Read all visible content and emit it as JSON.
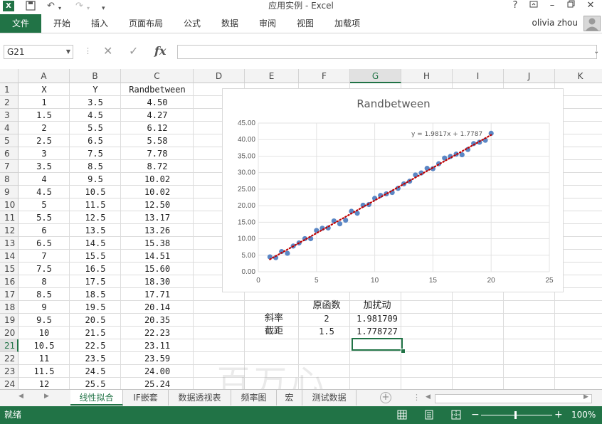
{
  "window": {
    "title": "应用实例 - Excel",
    "help_label": "?",
    "quick_access": {
      "undo_icon": "undo-icon",
      "redo_icon": "redo-icon",
      "save_icon": "save-icon"
    }
  },
  "ribbon": {
    "file_label": "文件",
    "tabs": [
      "开始",
      "插入",
      "页面布局",
      "公式",
      "数据",
      "审阅",
      "视图",
      "加载项"
    ],
    "user_name": "olivia zhou"
  },
  "formula_bar": {
    "name_box": "G21",
    "fx_label": "fx",
    "formula": ""
  },
  "columns": [
    "A",
    "B",
    "C",
    "D",
    "E",
    "F",
    "G",
    "H",
    "I",
    "J",
    "K"
  ],
  "rows": [
    "1",
    "2",
    "3",
    "4",
    "5",
    "6",
    "7",
    "8",
    "9",
    "10",
    "11",
    "12",
    "13",
    "14",
    "15",
    "16",
    "17",
    "18",
    "19",
    "20",
    "21",
    "22",
    "23",
    "24"
  ],
  "cells": {
    "headers": [
      "X",
      "Y",
      "Randbetween"
    ],
    "data": [
      [
        "1",
        "3.5",
        "4.50"
      ],
      [
        "1.5",
        "4.5",
        "4.27"
      ],
      [
        "2",
        "5.5",
        "6.12"
      ],
      [
        "2.5",
        "6.5",
        "5.58"
      ],
      [
        "3",
        "7.5",
        "7.78"
      ],
      [
        "3.5",
        "8.5",
        "8.72"
      ],
      [
        "4",
        "9.5",
        "10.02"
      ],
      [
        "4.5",
        "10.5",
        "10.02"
      ],
      [
        "5",
        "11.5",
        "12.50"
      ],
      [
        "5.5",
        "12.5",
        "13.17"
      ],
      [
        "6",
        "13.5",
        "13.26"
      ],
      [
        "6.5",
        "14.5",
        "15.38"
      ],
      [
        "7",
        "15.5",
        "14.51"
      ],
      [
        "7.5",
        "16.5",
        "15.60"
      ],
      [
        "8",
        "17.5",
        "18.30"
      ],
      [
        "8.5",
        "18.5",
        "17.71"
      ],
      [
        "9",
        "19.5",
        "20.14"
      ],
      [
        "9.5",
        "20.5",
        "20.35"
      ],
      [
        "10",
        "21.5",
        "22.23"
      ],
      [
        "10.5",
        "22.5",
        "23.11"
      ],
      [
        "11",
        "23.5",
        "23.59"
      ],
      [
        "11.5",
        "24.5",
        "24.00"
      ],
      [
        "12",
        "25.5",
        "25.24"
      ]
    ],
    "summary": {
      "col_f_header": "原函数",
      "col_g_header": "加扰动",
      "slope_label": "斜率",
      "slope_orig": "2",
      "slope_fit": "1.981709",
      "intercept_label": "截距",
      "intercept_orig": "1.5",
      "intercept_fit": "1.778727"
    }
  },
  "chart_data": {
    "type": "scatter",
    "title": "Randbetween",
    "trendline_label": "y = 1.9817x + 1.7787",
    "xlim": [
      0,
      25
    ],
    "ylim": [
      0,
      45
    ],
    "x_ticks": [
      "0",
      "5",
      "10",
      "15",
      "20",
      "25"
    ],
    "y_ticks": [
      "0.00",
      "5.00",
      "10.00",
      "15.00",
      "20.00",
      "25.00",
      "30.00",
      "35.00",
      "40.00",
      "45.00"
    ],
    "grid": true,
    "point_color": "#5b87c5",
    "trend_color": "#c00000",
    "trendline": {
      "slope": 1.9817,
      "intercept": 1.7787,
      "x_range": [
        1,
        20
      ]
    },
    "x": [
      1,
      1.5,
      2,
      2.5,
      3,
      3.5,
      4,
      4.5,
      5,
      5.5,
      6,
      6.5,
      7,
      7.5,
      8,
      8.5,
      9,
      9.5,
      10,
      10.5,
      11,
      11.5,
      12,
      12.5,
      13,
      13.5,
      14,
      14.5,
      15,
      15.5,
      16,
      16.5,
      17,
      17.5,
      18,
      18.5,
      19,
      19.5,
      20
    ],
    "y": [
      4.5,
      4.27,
      6.12,
      5.58,
      7.78,
      8.72,
      10.02,
      10.02,
      12.5,
      13.17,
      13.26,
      15.38,
      14.51,
      15.6,
      18.3,
      17.71,
      20.14,
      20.35,
      22.23,
      23.11,
      23.59,
      24.0,
      25.24,
      26.6,
      27.4,
      29.3,
      29.9,
      31.3,
      31.2,
      32.7,
      34.4,
      34.9,
      35.6,
      35.4,
      37.0,
      38.8,
      39.2,
      39.8,
      41.9
    ]
  },
  "watermark": "百万心",
  "sheets": {
    "tabs": [
      "线性拟合",
      "IF嵌套",
      "数据透视表",
      "频率图",
      "宏",
      "测试数据"
    ],
    "active": "线性拟合"
  },
  "status": {
    "text": "就绪",
    "zoom": "100%",
    "zoom_minus": "−",
    "zoom_plus": "+"
  },
  "colors": {
    "excel_green": "#217346",
    "grid_line": "#dcdcdc"
  }
}
